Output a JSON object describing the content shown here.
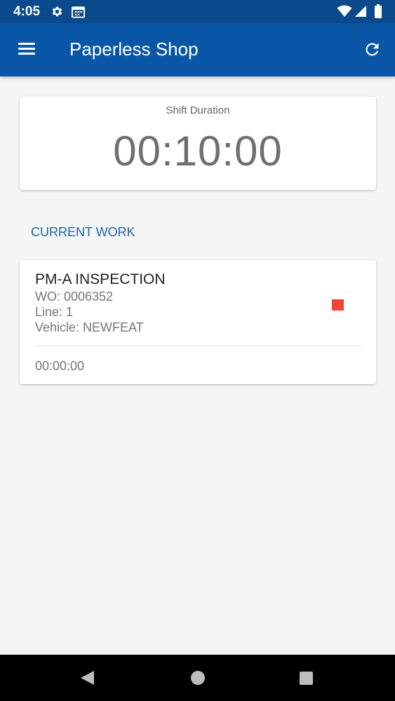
{
  "status_bar": {
    "time": "4:05",
    "icons": [
      "gear-icon",
      "calendar-icon",
      "wifi-icon",
      "signal-icon",
      "battery-icon"
    ]
  },
  "app_bar": {
    "title": "Paperless Shop",
    "left_icon": "menu-icon",
    "right_icon": "refresh-icon"
  },
  "shift": {
    "label": "Shift Duration",
    "duration": "00:10:00"
  },
  "current_work": {
    "section_title": "CURRENT WORK",
    "title": "PM-A INSPECTION",
    "wo": "WO: 0006352",
    "line": "Line: 1",
    "vehicle": "Vehicle: NEWFEAT",
    "timer": "00:00:00",
    "stop_icon": "stop-icon"
  },
  "colors": {
    "status_bar": "#0a4a8c",
    "app_bar": "#0a56a6",
    "accent_text": "#1f67a8",
    "stop": "#f44336",
    "background": "#f5f5f5"
  },
  "nav_bar": {
    "icons": [
      "back-icon",
      "home-icon",
      "recents-icon"
    ]
  }
}
